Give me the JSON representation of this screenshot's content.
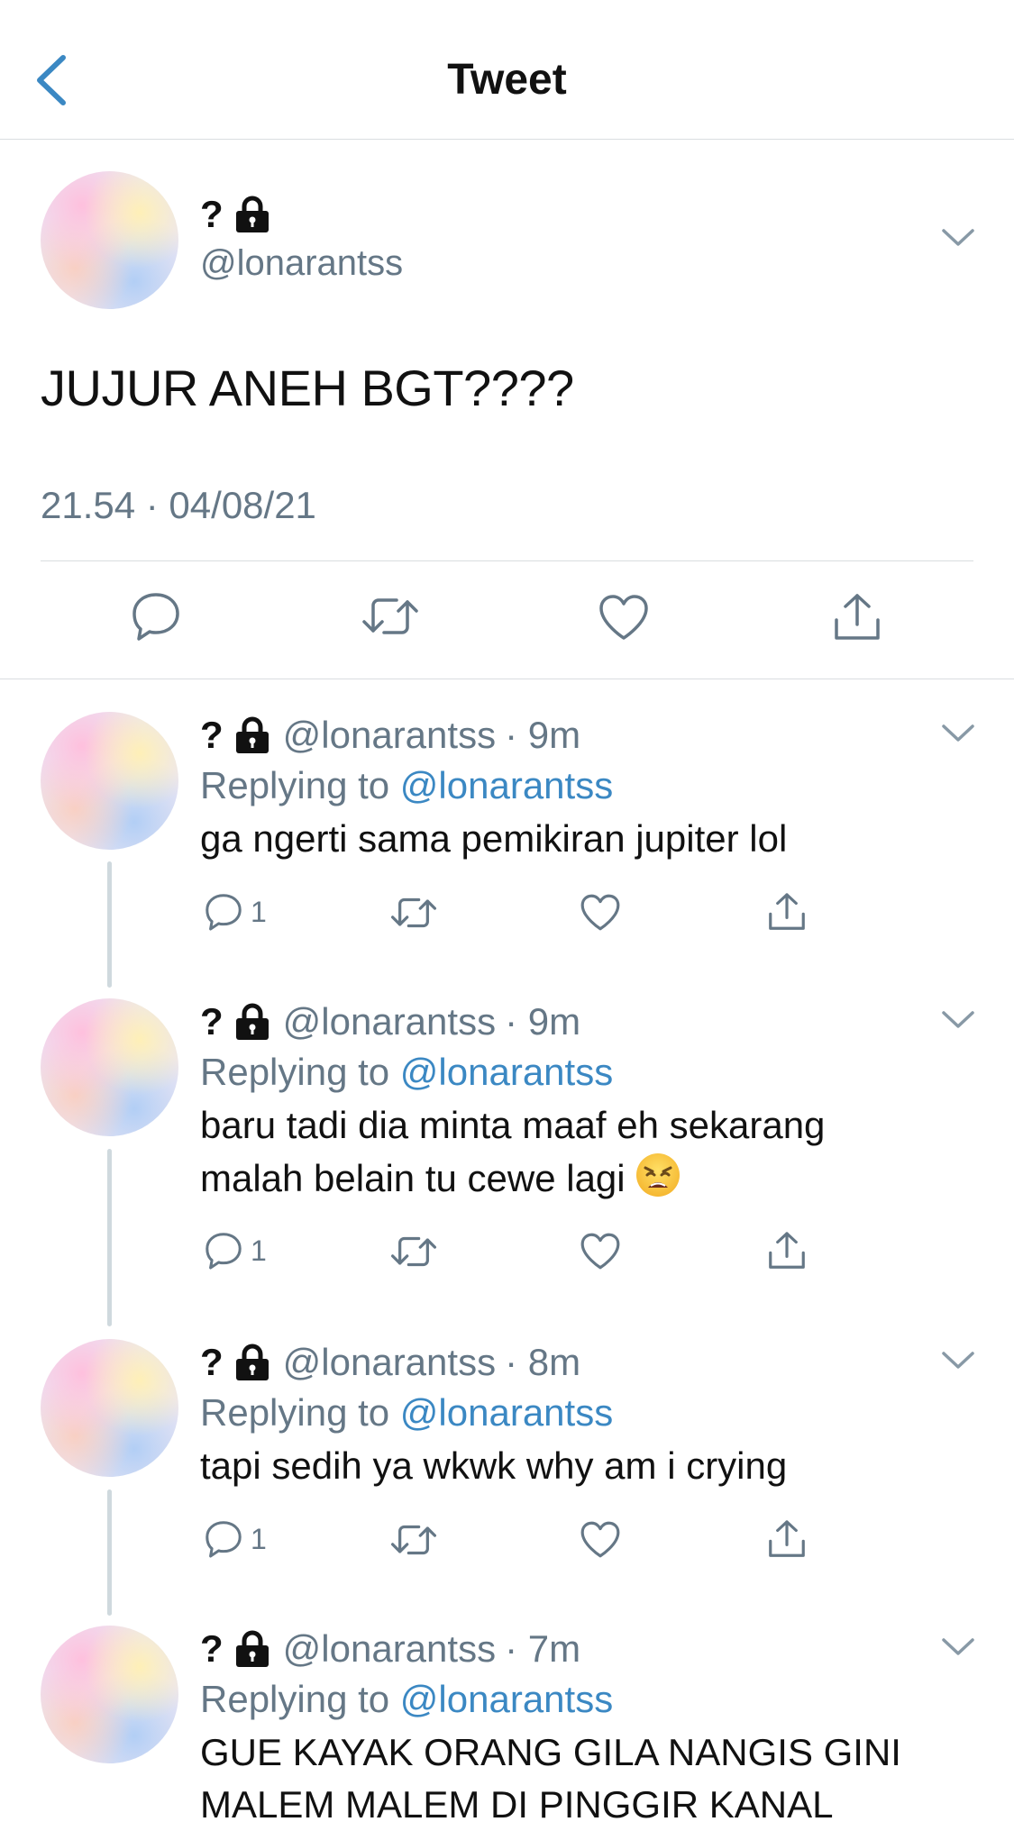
{
  "header": {
    "title": "Tweet"
  },
  "main_tweet": {
    "name": "?",
    "handle": "@lonarantss",
    "text": "JUJUR ANEH BGT????",
    "timestamp": "21.54 · 04/08/21"
  },
  "replies": [
    {
      "name": "?",
      "handle": "@lonarantss",
      "time": "· 9m",
      "replying_prefix": "Replying to ",
      "replying_to": "@lonarantss",
      "lines": [
        "ga ngerti sama pemikiran jupiter lol"
      ],
      "reply_count": "1"
    },
    {
      "name": "?",
      "handle": "@lonarantss",
      "time": "· 9m",
      "replying_prefix": "Replying to ",
      "replying_to": "@lonarantss",
      "lines": [
        "baru tadi dia minta maaf eh sekarang",
        "malah belain tu cewe lagi"
      ],
      "reply_count": "1"
    },
    {
      "name": "?",
      "handle": "@lonarantss",
      "time": "· 8m",
      "replying_prefix": "Replying to ",
      "replying_to": "@lonarantss",
      "lines": [
        "tapi sedih ya wkwk why am i crying"
      ],
      "reply_count": "1"
    },
    {
      "name": "?",
      "handle": "@lonarantss",
      "time": "· 7m",
      "replying_prefix": "Replying to ",
      "replying_to": "@lonarantss",
      "lines": [
        "GUE KAYAK ORANG GILA NANGIS GINI",
        "MALEM MALEM DI PINGGIR KANAL"
      ]
    }
  ],
  "icons": {
    "back": "chevron-left-icon",
    "lock": "lock-icon",
    "more": "chevron-down-icon",
    "reply": "reply-icon",
    "retweet": "retweet-icon",
    "like": "heart-icon",
    "share": "share-icon",
    "emoji": "weary-face-emoji"
  },
  "colors": {
    "accent": "#3b88c3",
    "muted": "#657786",
    "divider": "#d9dde0"
  }
}
